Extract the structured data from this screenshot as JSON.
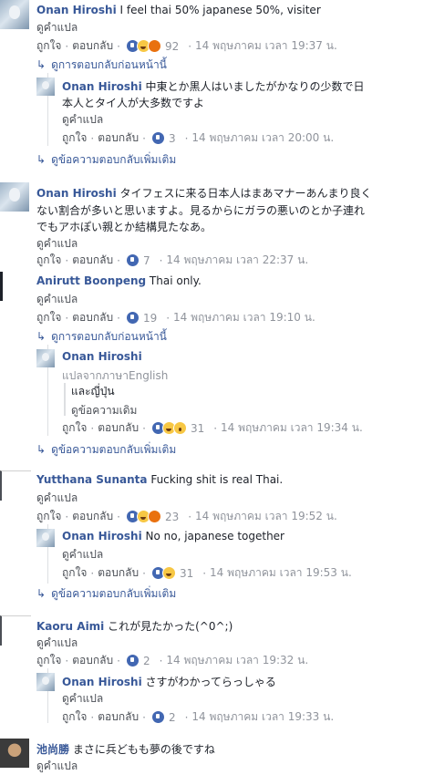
{
  "c1": {
    "name": "Onan Hiroshi",
    "text": "I feel thai 50%    japanese 50%, visiter",
    "translate": "ดูคำแปล",
    "like": "ถูกใจ",
    "reply": "ตอบกลับ",
    "count": "92",
    "time": "14 พฤษภาคม เวลา 19:37 น."
  },
  "c1_prev": "ดูการตอบกลับก่อนหน้านี้",
  "c1r1": {
    "name": "Onan Hiroshi",
    "text1": "中東とか黒人はいましたがかなりの少数で日",
    "text2": "本人とタイ人が大多数ですよ",
    "translate": "ดูคำแปล",
    "like": "ถูกใจ",
    "reply": "ตอบกลับ",
    "count": "3",
    "time": "14 พฤษภาคม เวลา 20:00 น."
  },
  "c1_more": "ดูข้อความตอบกลับเพิ่มเติม",
  "c2": {
    "name": "Onan Hiroshi",
    "text1": "タイフェスに来る日本人はまあマナーあんまり良く",
    "text2": "ない割合が多いと思いますよ。見るからにガラの悪いのとか子連れ",
    "text3": "でもアホぽい親とか結構見たなあ。",
    "translate": "ดูคำแปล",
    "like": "ถูกใจ",
    "reply": "ตอบกลับ",
    "count": "7",
    "time": "14 พฤษภาคม เวลา 22:37 น."
  },
  "c3": {
    "name": "Anirutt Boonpeng",
    "text": "Thai only.",
    "translate": "ดูคำแปล",
    "like": "ถูกใจ",
    "reply": "ตอบกลับ",
    "count": "19",
    "time": "14 พฤษภาคม เวลา 19:10 น."
  },
  "c3_prev": "ดูการตอบกลับก่อนหน้านี้",
  "c3r1": {
    "name": "Onan Hiroshi",
    "sub": "แปลจากภาษาEnglish",
    "q1": "และญี่ปุ่น",
    "q2": "ดูข้อความเดิม",
    "like": "ถูกใจ",
    "reply": "ตอบกลับ",
    "count": "31",
    "time": "14 พฤษภาคม เวลา 19:34 น."
  },
  "c3_more": "ดูข้อความตอบกลับเพิ่มเติม",
  "c4": {
    "name": "Yutthana Sunanta",
    "text": "Fucking shit is real Thai.",
    "translate": "ดูคำแปล",
    "like": "ถูกใจ",
    "reply": "ตอบกลับ",
    "count": "23",
    "time": "14 พฤษภาคม เวลา 19:52 น."
  },
  "c4r1": {
    "name": "Onan Hiroshi",
    "text": "No no, japanese together",
    "translate": "ดูคำแปล",
    "like": "ถูกใจ",
    "reply": "ตอบกลับ",
    "count": "31",
    "time": "14 พฤษภาคม เวลา 19:53 น."
  },
  "c4_more": "ดูข้อความตอบกลับเพิ่มเติม",
  "c5": {
    "name": "Kaoru Aimi",
    "text": "これが見たかった(^0^;)",
    "translate": "ดูคำแปล",
    "like": "ถูกใจ",
    "reply": "ตอบกลับ",
    "count": "2",
    "time": "14 พฤษภาคม เวลา 19:32 น."
  },
  "c5r1": {
    "name": "Onan Hiroshi",
    "text": "さすがわかってらっしゃる",
    "translate": "ดูคำแปล",
    "like": "ถูกใจ",
    "reply": "ตอบกลับ",
    "count": "2",
    "time": "14 พฤษภาคม เวลา 19:33 น."
  },
  "c6": {
    "name": "池尚勝",
    "text": "まさに兵どもも夢の後ですね",
    "translate": "ดูคำแปล"
  },
  "colors": {
    "link": "#385898",
    "meta": "#90949c",
    "text": "#1d2129"
  }
}
